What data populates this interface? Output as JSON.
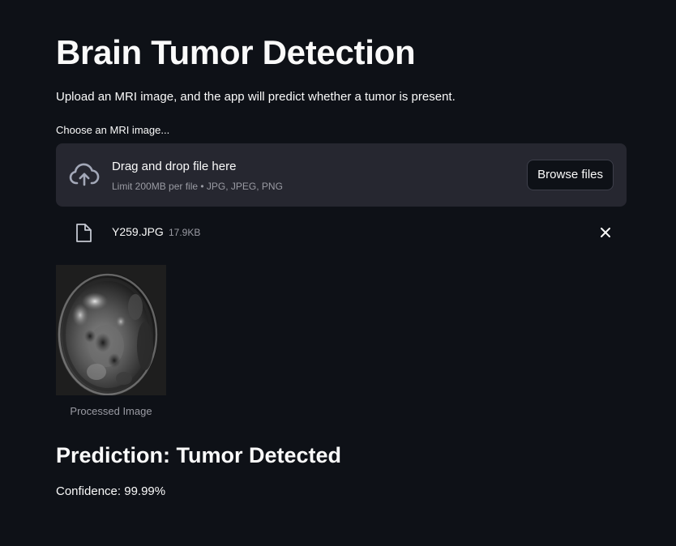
{
  "app": {
    "title": "Brain Tumor Detection",
    "description": "Upload an MRI image, and the app will predict whether a tumor is present."
  },
  "uploader": {
    "label": "Choose an MRI image...",
    "drop_title": "Drag and drop file here",
    "drop_hint": "Limit 200MB per file • JPG, JPEG, PNG",
    "browse_label": "Browse files",
    "upload_icon": "cloud-upload-icon"
  },
  "uploaded_file": {
    "name": "Y259.JPG",
    "size": "17.9KB",
    "file_icon": "file-icon",
    "remove_icon": "close-icon"
  },
  "image": {
    "caption": "Processed Image"
  },
  "result": {
    "prediction": "Prediction: Tumor Detected",
    "confidence": "Confidence: 99.99%"
  },
  "colors": {
    "background": "#0e1117",
    "dropzone": "#262730",
    "text": "#fafafa",
    "muted": "#9a9ba3"
  }
}
